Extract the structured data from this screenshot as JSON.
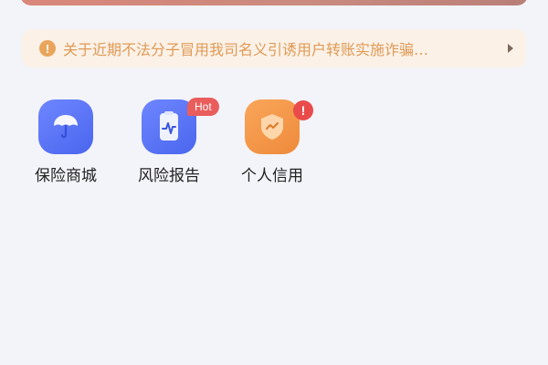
{
  "notice": {
    "icon": "exclamation-circle-icon",
    "icon_glyph": "!",
    "text": "关于近期不法分子冒用我司名义引诱用户转账实施诈骗…",
    "arrow_icon": "play-arrow-icon"
  },
  "services": [
    {
      "label": "保险商城",
      "icon": "umbrella-icon",
      "color": "#5a74f5"
    },
    {
      "label": "风险报告",
      "icon": "report-chart-icon",
      "color": "#5a74f5",
      "badge": "Hot"
    },
    {
      "label": "个人信用",
      "icon": "credit-shield-icon",
      "color": "#f29244",
      "badge": "!"
    }
  ],
  "colors": {
    "background": "#f3f4f9",
    "notice_background": "#fbf1e7",
    "notice_text": "#e09a55",
    "badge_red": "#ea5d5d"
  }
}
